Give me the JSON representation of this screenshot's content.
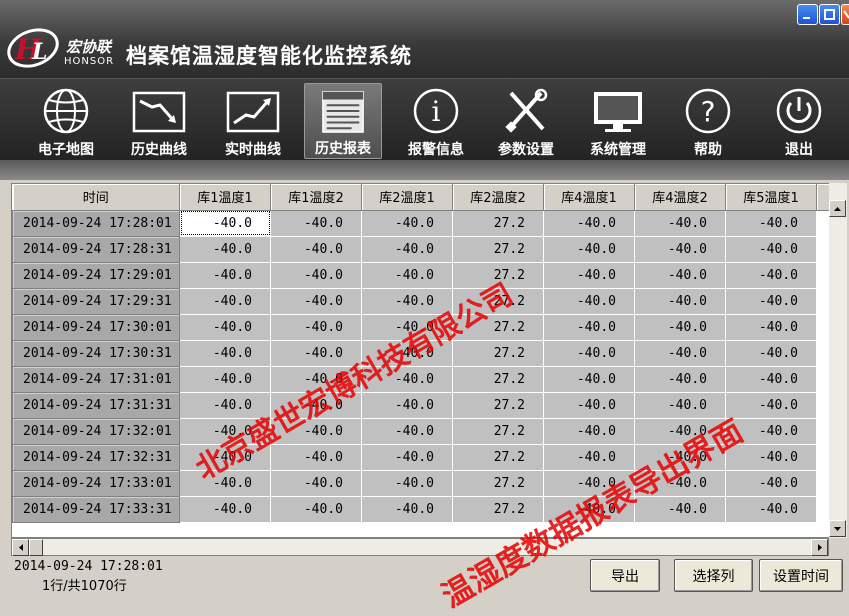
{
  "window": {
    "title": "档案馆温湿度智能化监控系统",
    "logo_cn": "宏协联",
    "logo_en": "HONSOR"
  },
  "toolbar": {
    "items": [
      {
        "label": "电子地图",
        "icon": "globe-icon"
      },
      {
        "label": "历史曲线",
        "icon": "trend-down-chart-icon"
      },
      {
        "label": "实时曲线",
        "icon": "trend-up-chart-icon"
      },
      {
        "label": "历史报表",
        "icon": "report-icon",
        "active": true
      },
      {
        "label": "报警信息",
        "icon": "info-icon"
      },
      {
        "label": "参数设置",
        "icon": "tools-icon"
      },
      {
        "label": "系统管理",
        "icon": "monitor-icon"
      },
      {
        "label": "帮助",
        "icon": "help-icon"
      },
      {
        "label": "退出",
        "icon": "power-icon"
      }
    ]
  },
  "grid": {
    "columns": [
      "时间",
      "库1温度1",
      "库1温度2",
      "库2温度1",
      "库2温度2",
      "库4温度1",
      "库4温度2",
      "库5温度1"
    ],
    "rows": [
      [
        "2014-09-24 17:28:01",
        "-40.0",
        "-40.0",
        "-40.0",
        "27.2",
        "-40.0",
        "-40.0",
        "-40.0"
      ],
      [
        "2014-09-24 17:28:31",
        "-40.0",
        "-40.0",
        "-40.0",
        "27.2",
        "-40.0",
        "-40.0",
        "-40.0"
      ],
      [
        "2014-09-24 17:29:01",
        "-40.0",
        "-40.0",
        "-40.0",
        "27.2",
        "-40.0",
        "-40.0",
        "-40.0"
      ],
      [
        "2014-09-24 17:29:31",
        "-40.0",
        "-40.0",
        "-40.0",
        "27.2",
        "-40.0",
        "-40.0",
        "-40.0"
      ],
      [
        "2014-09-24 17:30:01",
        "-40.0",
        "-40.0",
        "-40.0",
        "27.2",
        "-40.0",
        "-40.0",
        "-40.0"
      ],
      [
        "2014-09-24 17:30:31",
        "-40.0",
        "-40.0",
        "-40.0",
        "27.2",
        "-40.0",
        "-40.0",
        "-40.0"
      ],
      [
        "2014-09-24 17:31:01",
        "-40.0",
        "-40.0",
        "-40.0",
        "27.2",
        "-40.0",
        "-40.0",
        "-40.0"
      ],
      [
        "2014-09-24 17:31:31",
        "-40.0",
        "-40.0",
        "-40.0",
        "27.2",
        "-40.0",
        "-40.0",
        "-40.0"
      ],
      [
        "2014-09-24 17:32:01",
        "-40.0",
        "-40.0",
        "-40.0",
        "27.2",
        "-40.0",
        "-40.0",
        "-40.0"
      ],
      [
        "2014-09-24 17:32:31",
        "-40.0",
        "-40.0",
        "-40.0",
        "27.2",
        "-40.0",
        "-40.0",
        "-40.0"
      ],
      [
        "2014-09-24 17:33:01",
        "-40.0",
        "-40.0",
        "-40.0",
        "27.2",
        "-40.0",
        "-40.0",
        "-40.0"
      ],
      [
        "2014-09-24 17:33:31",
        "-40.0",
        "-40.0",
        "-40.0",
        "27.2",
        "-40.0",
        "-40.0",
        "-40.0"
      ]
    ]
  },
  "status": {
    "selected_time": "2014-09-24 17:28:01",
    "row_info": "1行/共1070行"
  },
  "buttons": {
    "export": "导出",
    "select_columns": "选择列",
    "set_time": "设置时间"
  },
  "watermarks": {
    "company": "北京盛世宏博科技有限公司",
    "caption": "温湿度数据报表导出界面"
  },
  "colors": {
    "watermark": "#e60000",
    "toolbar_bg": "#2c2c2c"
  }
}
